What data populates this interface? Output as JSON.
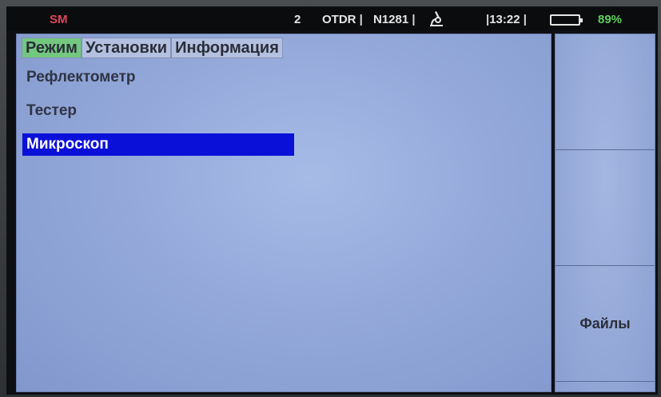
{
  "status_bar": {
    "mode": "SM",
    "channel": "2",
    "app": "OTDR",
    "separator": "|",
    "model": "N1281",
    "time": "13:22",
    "battery_percent": "89%",
    "battery_level": 0.89,
    "icons": [
      "microscope-icon",
      "battery-icon"
    ]
  },
  "tabs": [
    {
      "label": "Режим",
      "active": true
    },
    {
      "label": "Установки",
      "active": false
    },
    {
      "label": "Информация",
      "active": false
    }
  ],
  "menu": {
    "items": [
      {
        "label": "Рефлектометр",
        "selected": false
      },
      {
        "label": "Тестер",
        "selected": false
      },
      {
        "label": "Микроскоп",
        "selected": true
      }
    ]
  },
  "softkeys": [
    {
      "label": ""
    },
    {
      "label": ""
    },
    {
      "label": "Файлы"
    }
  ],
  "colors": {
    "active_tab": "#73c87f",
    "selection": "#0b10d9",
    "mode_text": "#e0455a",
    "battery_text": "#5fd35a"
  }
}
